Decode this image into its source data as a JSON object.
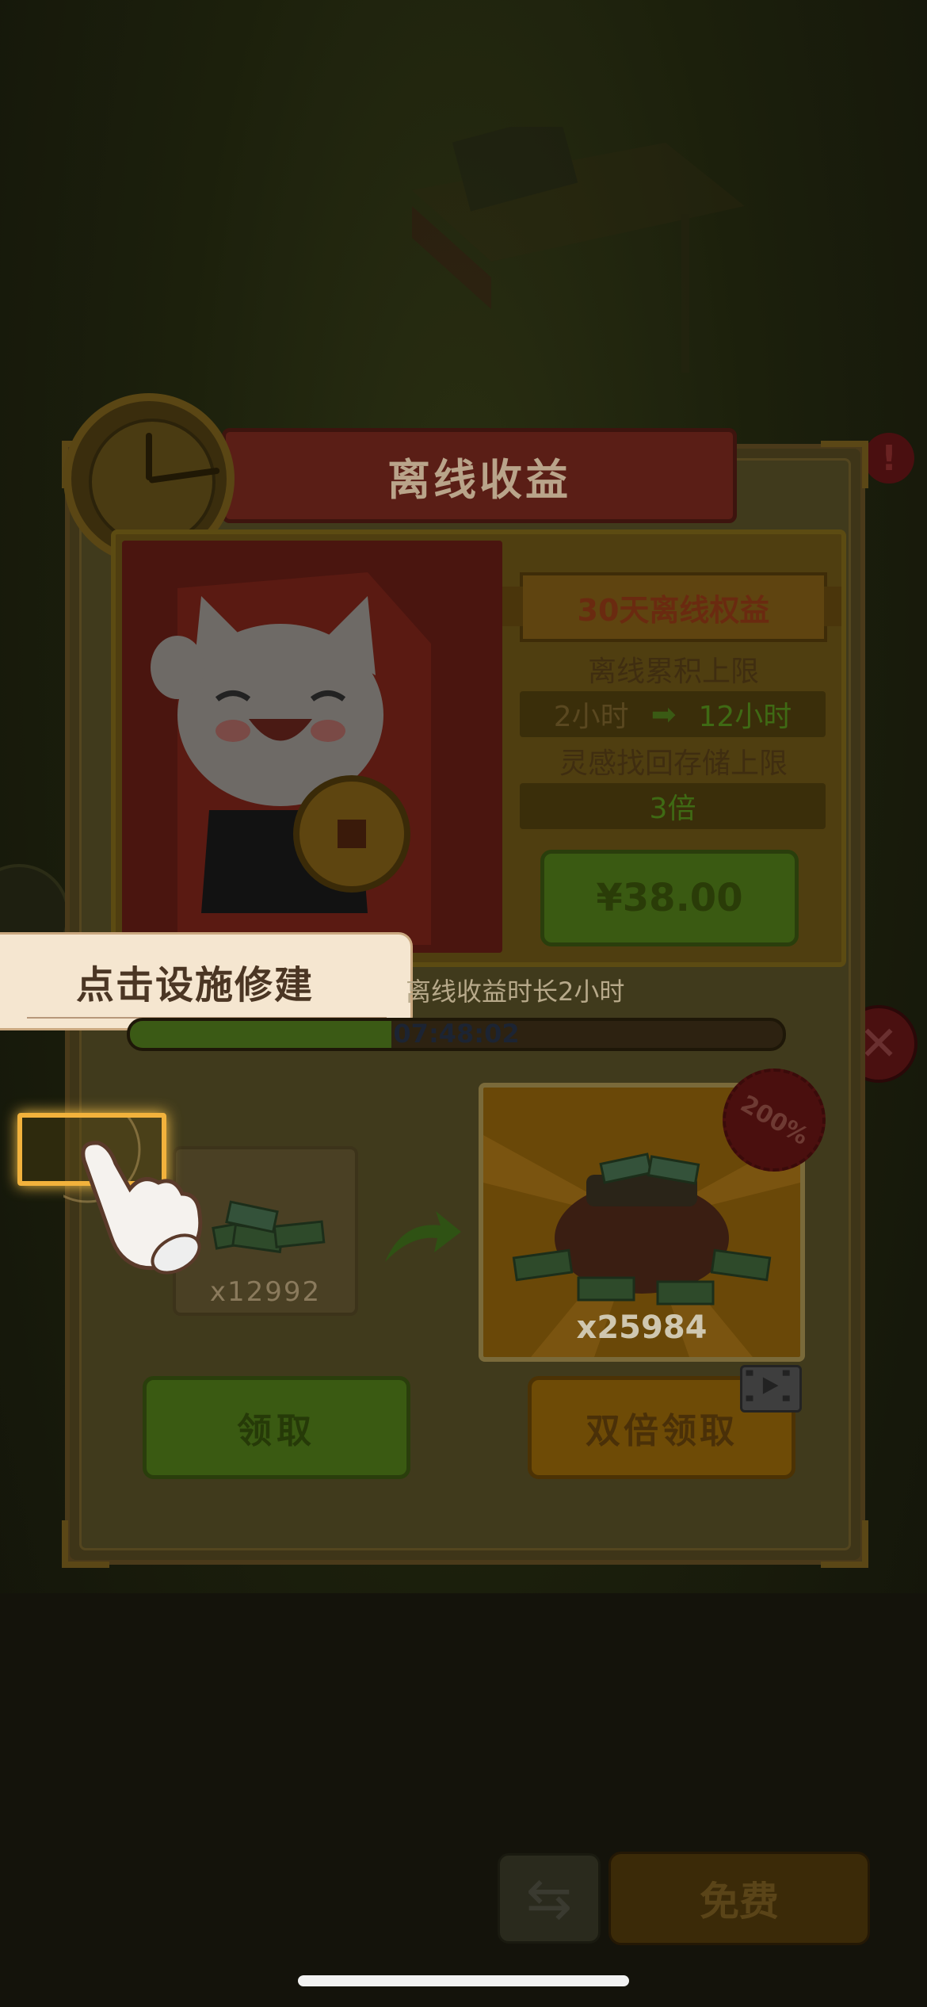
{
  "dialog": {
    "title": "离线收益",
    "promo": {
      "banner": "30天离线权益",
      "accum_limit_label": "离线累积上限",
      "accum_from": "2小时",
      "accum_to": "12小时",
      "storage_limit_label": "灵感找回存储上限",
      "storage_value": "3倍",
      "price": "¥38.00"
    },
    "duration_text": "离线收益时长2小时",
    "timer": "07:48:02",
    "progress_fraction": 0.4,
    "reward_normal": "x12992",
    "reward_double": "x25984",
    "double_badge": "200%",
    "claim_button": "领取",
    "double_claim_button": "双倍领取"
  },
  "tutorial": {
    "tooltip": "点击设施修建"
  },
  "background": {
    "free_button": "免费",
    "swap_icon": "⇆"
  },
  "colors": {
    "green_button": "#3a5a12",
    "gold_button": "#6e4b06",
    "ribbon_red": "#5a1e16",
    "tooltip_bg": "#f5e6d0"
  }
}
